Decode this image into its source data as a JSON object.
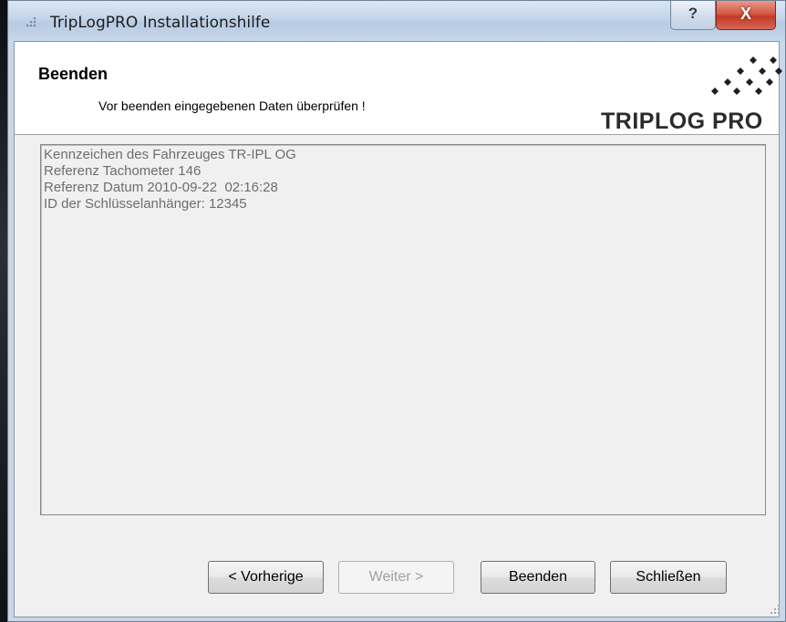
{
  "window": {
    "title": "TripLogPRO Installationshilfe",
    "help_glyph": "?",
    "close_glyph": "X",
    "icons": [
      "app-icon",
      "help-icon",
      "close-icon",
      "size-grip-icon"
    ]
  },
  "header": {
    "title": "Beenden",
    "subtitle": "Vor beenden eingegebenen Daten überprüfen !",
    "logo_text": "TRIPLOG PRO"
  },
  "summary": {
    "lines": [
      "Kennzeichen des Fahrzeuges TR-IPL OG",
      "Referenz Tachometer 146",
      "Referenz Datum 2010-09-22  02:16:28",
      "ID der Schlüsselanhänger: 12345"
    ]
  },
  "buttons": {
    "previous": "< Vorherige",
    "next": "Weiter >",
    "finish": "Beenden",
    "close": "Schließen"
  },
  "colors": {
    "title_bar": "#c3d4ea",
    "close_button": "#c23a22",
    "dialog_background": "#f0f0f0",
    "summary_text": "#6d6d6d"
  }
}
